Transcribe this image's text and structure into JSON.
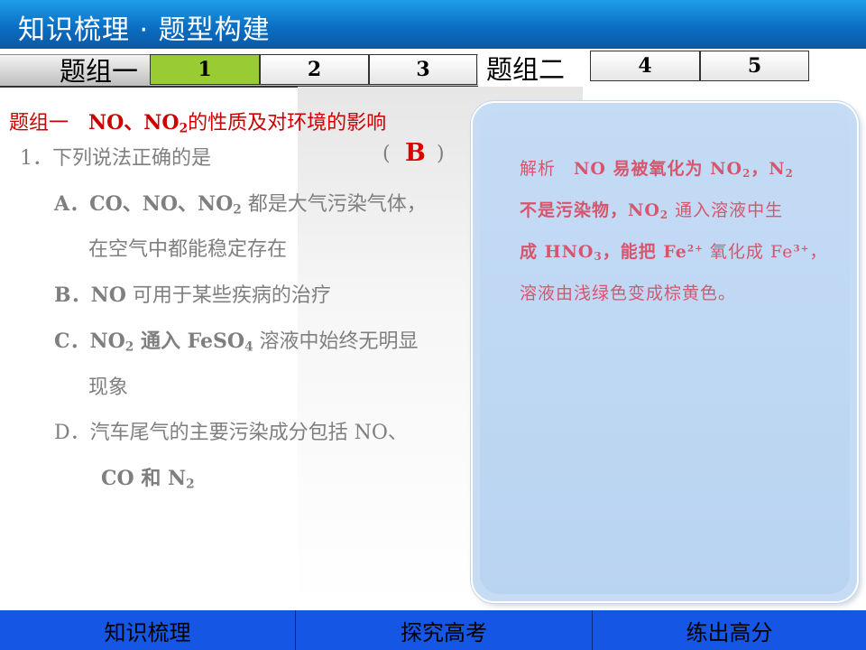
{
  "title": "知识梳理 · 题型构建",
  "tabs": {
    "group1_label": "题组一",
    "group2_label": "题组二",
    "group1_items": [
      "1",
      "2",
      "3"
    ],
    "group2_items": [
      "4",
      "5"
    ],
    "active": "1"
  },
  "heading": {
    "prefix": "题组一",
    "formula_a": "NO、NO",
    "formula_sub": "2",
    "suffix": "的性质及对环境的影响"
  },
  "question": {
    "stem": "1．下列说法正确的是",
    "answer_open": "(",
    "answer": "B",
    "answer_close": ")",
    "options": {
      "A_line1_a": "A．CO、NO、NO",
      "A_line1_sub": "2",
      "A_line1_b": " 都是大气污染气体，",
      "A_line2": "在空气中都能稳定存在",
      "B_a": "B．NO",
      "B_b": " 可用于某些疾病的治疗",
      "C_line1_a": "C．NO",
      "C_line1_sub1": "2",
      "C_line1_b": " 通入 FeSO",
      "C_line1_sub2": "4",
      "C_line1_c": " 溶液中始终无明显",
      "C_line2": "现象",
      "D_line1": "D．汽车尾气的主要污染成分包括 NO、",
      "D_line2_a": "CO 和 N",
      "D_line2_sub": "2"
    }
  },
  "analysis": {
    "label": "解析",
    "l1_a": "NO 易被氧化为 NO",
    "l1_sub": "2",
    "l1_b": "，N",
    "l1_sub2": "2",
    "l2_a": "不是污染物，NO",
    "l2_sub": "2",
    "l2_b": " 通入溶液中生",
    "l3_a": "成 HNO",
    "l3_sub": "3",
    "l3_b": "，能把 Fe",
    "l3_sup": "2+",
    "l3_c": " 氧化成 Fe",
    "l3_sup2": "3+",
    "l3_d": "，",
    "l4": "溶液由浅绿色变成棕黄色。"
  },
  "bottom_nav": [
    "知识梳理",
    "探究高考",
    "练出高分"
  ],
  "colors": {
    "title_bar": "#0b6fc3",
    "active_tab": "#99cc33",
    "heading": "#cc0000",
    "answer": "#dd0000",
    "analysis_text": "#d8556e",
    "analysis_bg": "#c5dcf4",
    "bottom_nav": "#1556e4"
  }
}
